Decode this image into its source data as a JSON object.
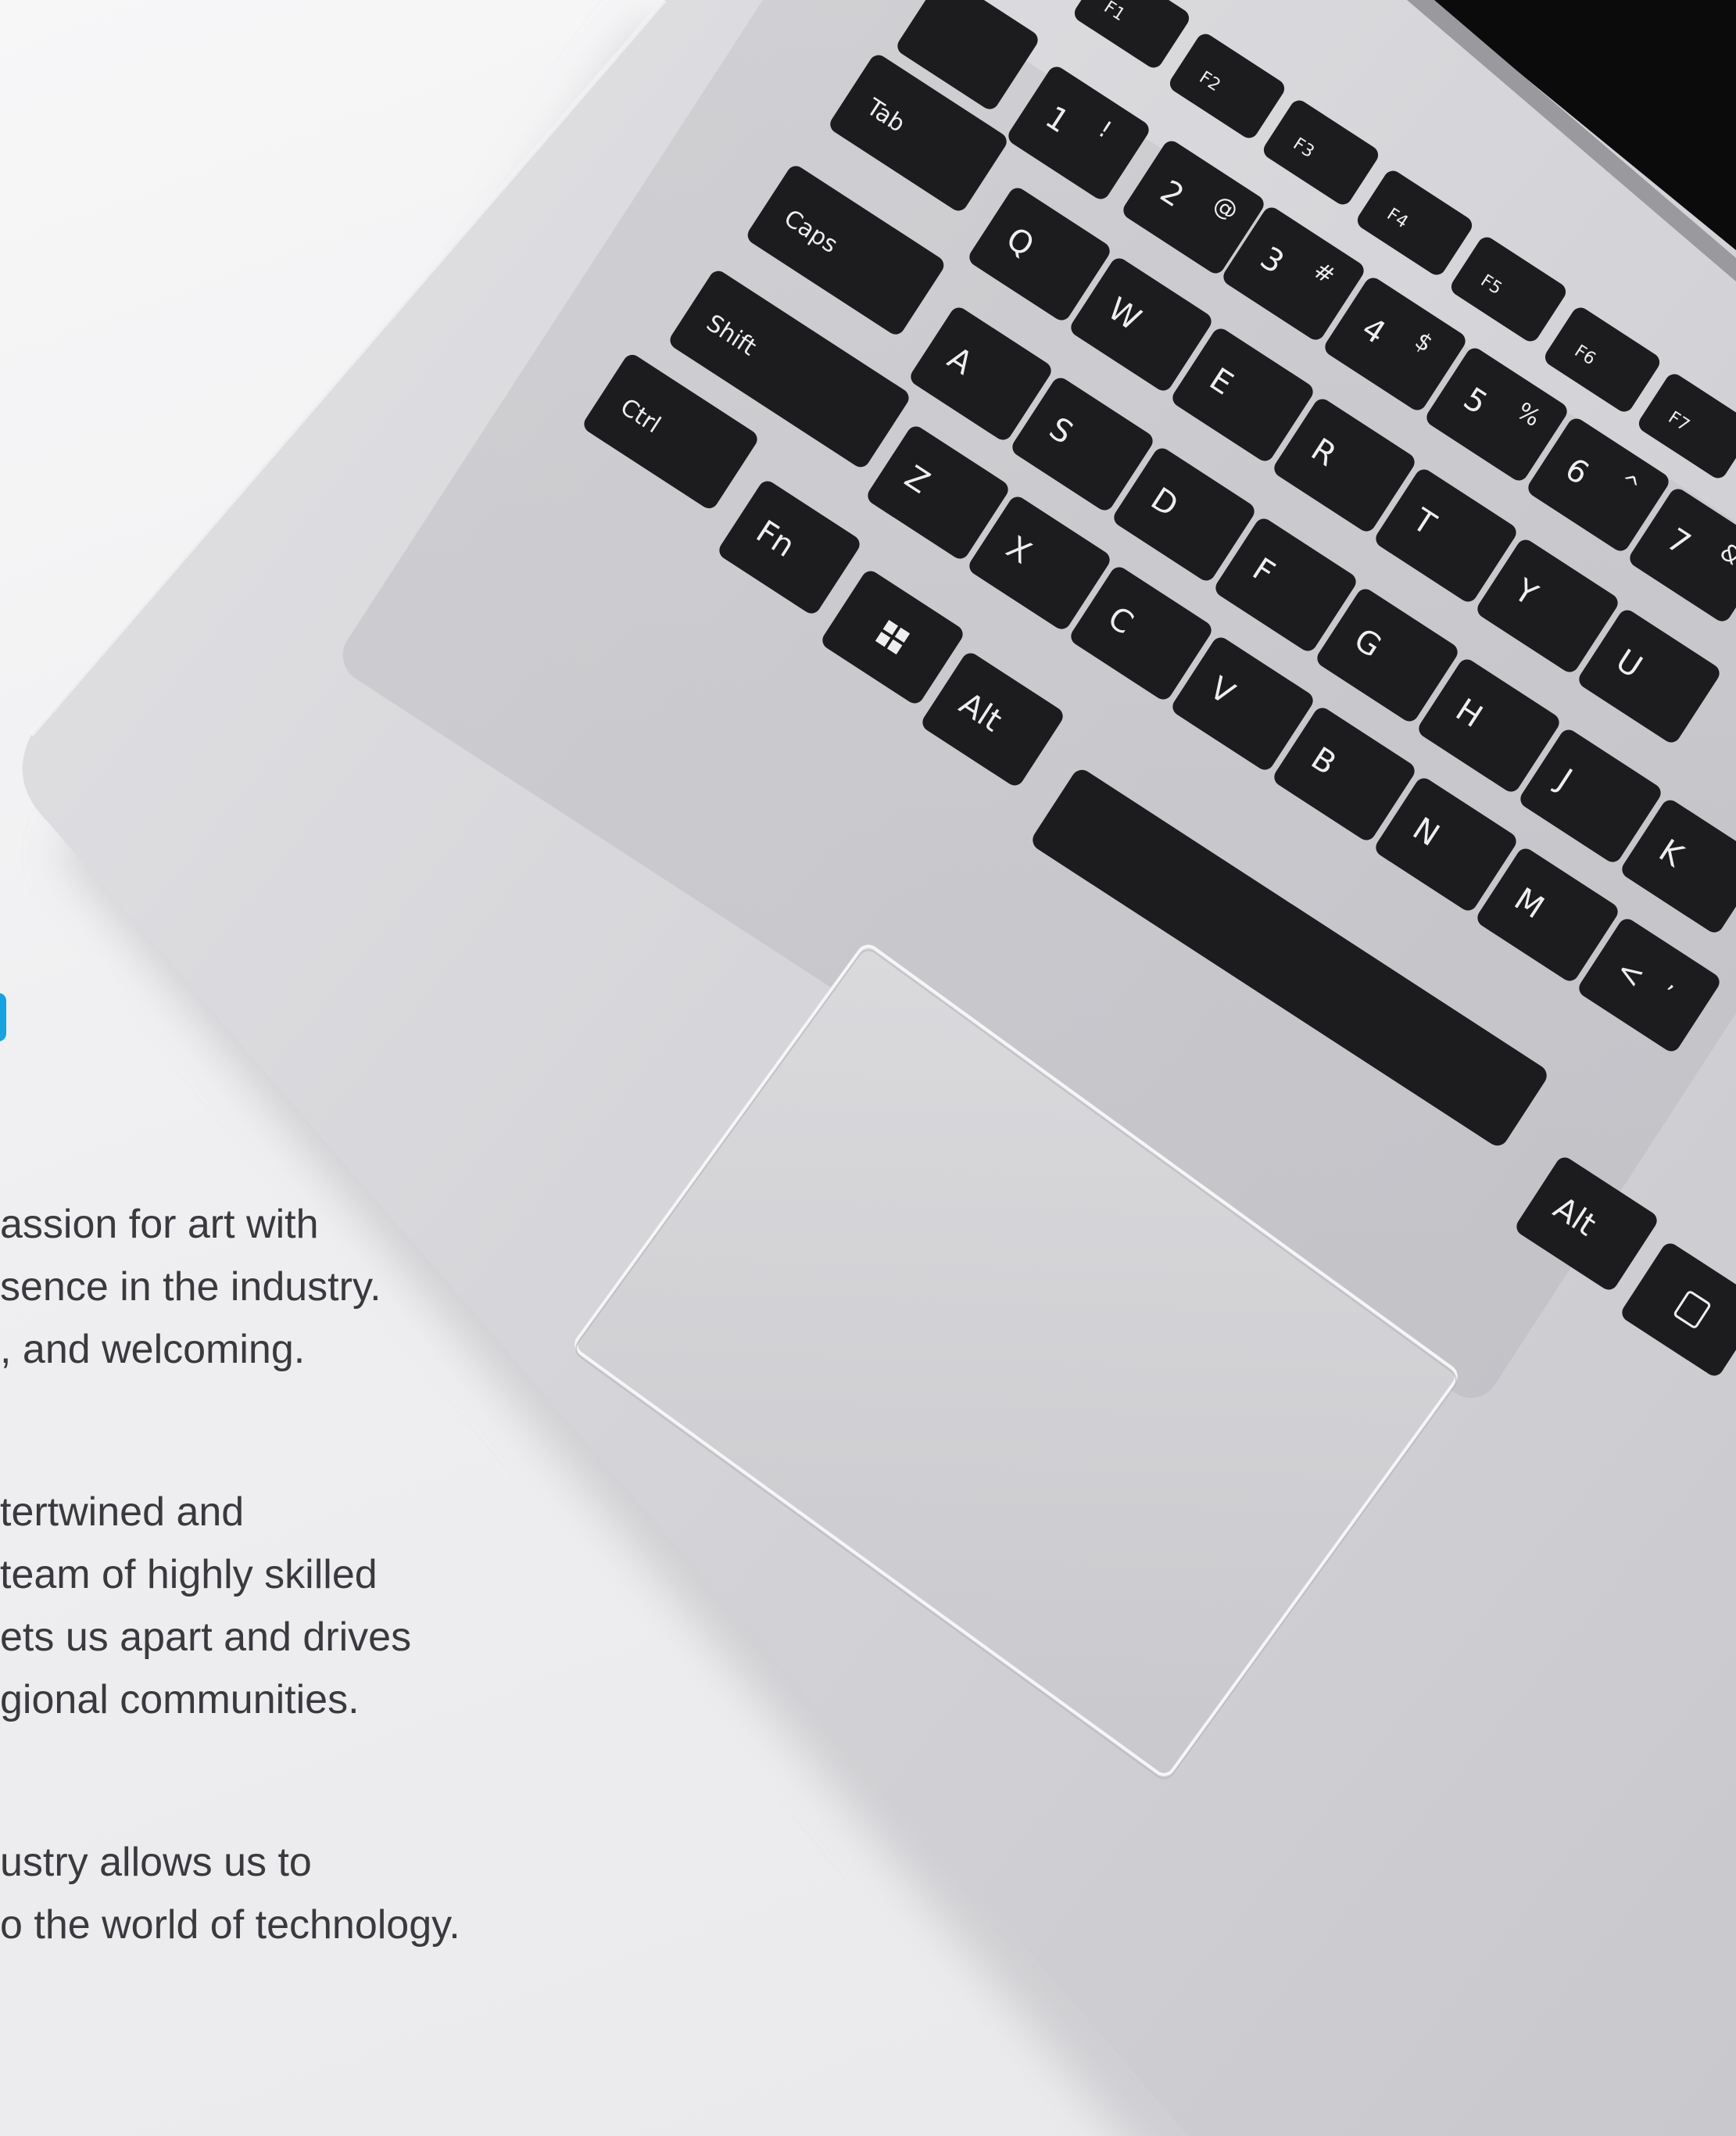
{
  "colors": {
    "accent": "#16a3e0",
    "body_text": "#3a3a3e",
    "background": "#f1f1f3",
    "laptop_body": "#d9d9dd",
    "key": "#1c1c1e",
    "key_label": "#eeeeee"
  },
  "hero_image": {
    "icon": "laptop-keyboard-photo",
    "keys": [
      {
        "label": "Tab",
        "sub": ""
      },
      {
        "label": "Caps",
        "sub": ""
      },
      {
        "label": "Shift",
        "sub": ""
      },
      {
        "label": "Ctrl",
        "sub": ""
      },
      {
        "label": "Fn",
        "sub": ""
      },
      {
        "label": "",
        "sub": "windows-logo-icon"
      },
      {
        "label": "Alt",
        "sub": ""
      },
      {
        "label": "Alt",
        "sub": ""
      },
      {
        "label": "",
        "sub": "menu-key-icon"
      },
      {
        "label": "1",
        "sub": "!"
      },
      {
        "label": "2",
        "sub": "@"
      },
      {
        "label": "3",
        "sub": "#"
      },
      {
        "label": "4",
        "sub": "$"
      },
      {
        "label": "5",
        "sub": "%"
      },
      {
        "label": "6",
        "sub": "^"
      },
      {
        "label": "7",
        "sub": "&"
      },
      {
        "label": "Q",
        "sub": ""
      },
      {
        "label": "W",
        "sub": ""
      },
      {
        "label": "E",
        "sub": ""
      },
      {
        "label": "R",
        "sub": ""
      },
      {
        "label": "T",
        "sub": ""
      },
      {
        "label": "Y",
        "sub": ""
      },
      {
        "label": "U",
        "sub": ""
      },
      {
        "label": "A",
        "sub": ""
      },
      {
        "label": "S",
        "sub": ""
      },
      {
        "label": "D",
        "sub": ""
      },
      {
        "label": "F",
        "sub": ""
      },
      {
        "label": "G",
        "sub": ""
      },
      {
        "label": "H",
        "sub": ""
      },
      {
        "label": "J",
        "sub": ""
      },
      {
        "label": "K",
        "sub": ""
      },
      {
        "label": "Z",
        "sub": ""
      },
      {
        "label": "X",
        "sub": ""
      },
      {
        "label": "C",
        "sub": ""
      },
      {
        "label": "V",
        "sub": ""
      },
      {
        "label": "B",
        "sub": ""
      },
      {
        "label": "N",
        "sub": ""
      },
      {
        "label": "M",
        "sub": ""
      },
      {
        "label": "<",
        "sub": ","
      },
      {
        "label": "F1",
        "sub": ""
      },
      {
        "label": "F2",
        "sub": ""
      },
      {
        "label": "F3",
        "sub": ""
      },
      {
        "label": "F4",
        "sub": ""
      },
      {
        "label": "F5",
        "sub": ""
      },
      {
        "label": "F6",
        "sub": ""
      },
      {
        "label": "F7",
        "sub": ""
      }
    ]
  },
  "text_block": {
    "paragraphs": [
      {
        "lines": [
          "assion for art with",
          "sence in the industry.",
          ", and welcoming."
        ]
      },
      {
        "lines": [
          "tertwined and",
          "team of highly skilled",
          "ets us apart and drives",
          "gional communities."
        ]
      },
      {
        "lines": [
          "ustry allows us to",
          "o the world of technology."
        ]
      }
    ]
  }
}
